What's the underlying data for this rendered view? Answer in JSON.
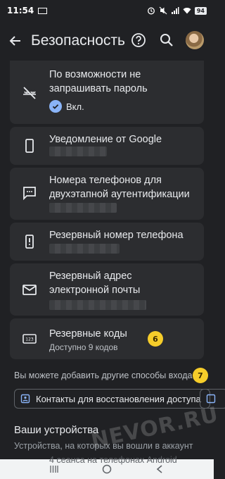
{
  "status_bar": {
    "time": "11:54",
    "battery": "94"
  },
  "app_bar": {
    "title": "Безопасность"
  },
  "cards": {
    "password": {
      "label": "По возможности не запрашивать пароль",
      "chip": "Вкл."
    },
    "google_notify": {
      "label": "Уведомление от Google"
    },
    "two_step_phones": {
      "label": "Номера телефонов для двухэтапной аутентификации"
    },
    "backup_phone": {
      "label": "Резервный номер телефона"
    },
    "backup_email": {
      "label": "Резервный адрес электронной почты"
    },
    "backup_codes": {
      "label": "Резервные коды",
      "sub": "Доступно 9 кодов",
      "badge": "6"
    }
  },
  "hint": {
    "text": "Вы можете добавить другие способы входа",
    "badge": "7"
  },
  "buttons": {
    "recovery_contacts": "Контакты для восстановления доступа"
  },
  "devices": {
    "title": "Ваши устройства",
    "subtitle": "Устройства, на которых вы вошли в аккаунт",
    "peek": "4 сеанса на телефонах Android"
  },
  "watermark": "NEVOR.RU",
  "colors": {
    "accent": "#8ab4f8",
    "badge": "#f6cd2a",
    "card": "#2c2d30",
    "background": "#202124"
  }
}
